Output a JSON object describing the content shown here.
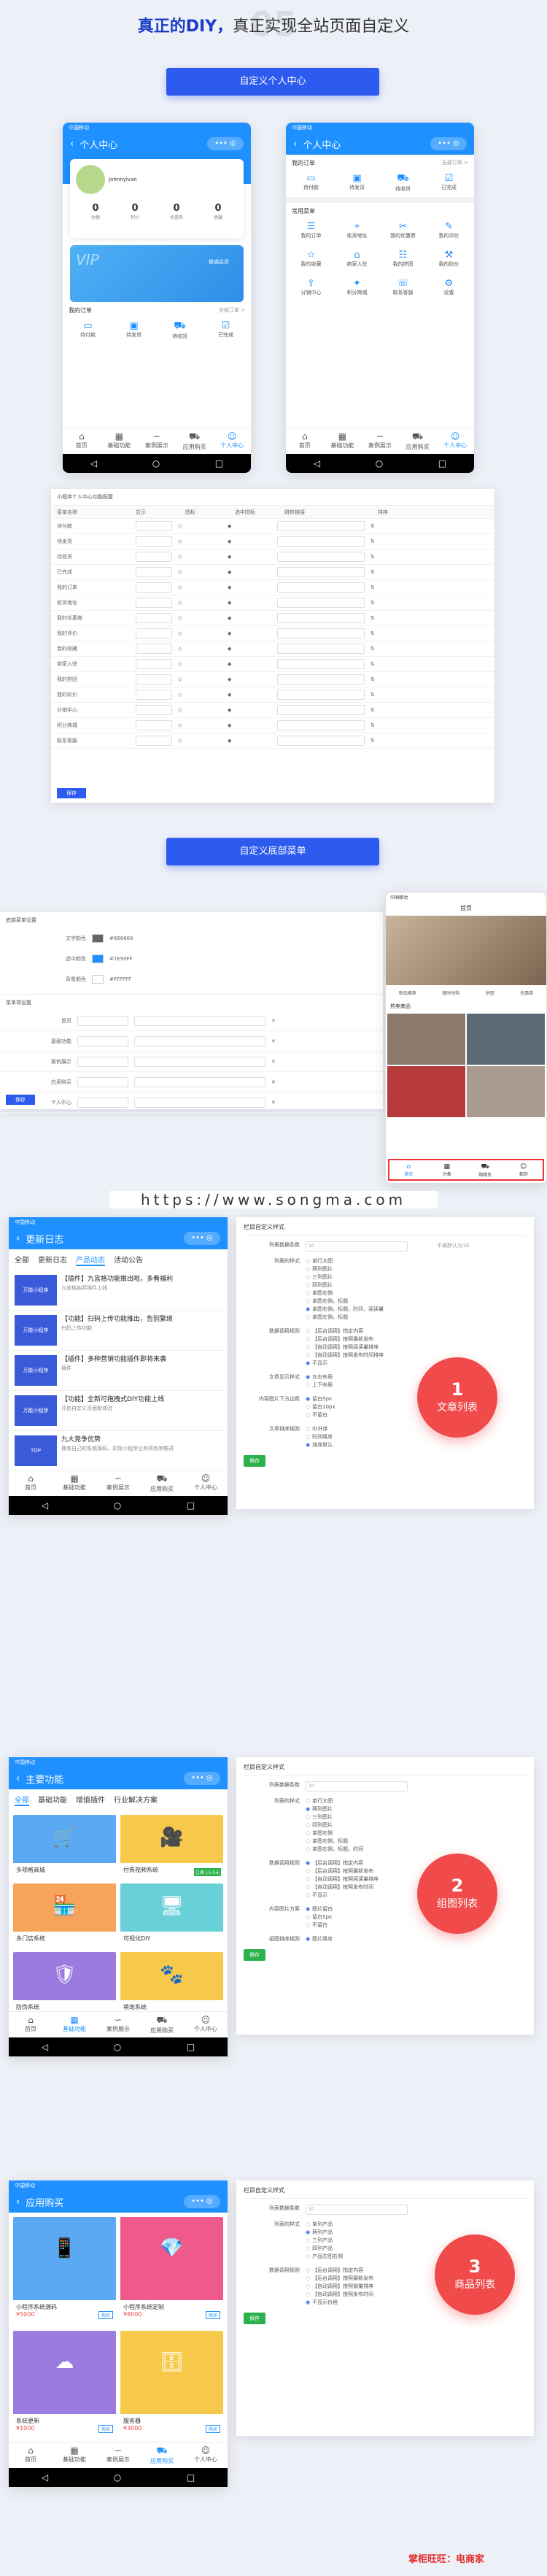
{
  "hero": {
    "bold": "真正的DIY，",
    "rest": "真正实现全站页面自定义",
    "num": "05"
  },
  "pill1": "自定义个人中心",
  "pill2": "自定义底部菜单",
  "status": "中国移动",
  "p1": {
    "title": "个人中心",
    "user": "Johnnylvan",
    "stats": [
      {
        "v": "0",
        "l": "余额"
      },
      {
        "v": "0",
        "l": "积分"
      },
      {
        "v": "0",
        "l": "优惠券"
      },
      {
        "v": "0",
        "l": "收藏"
      }
    ],
    "vip": "VIP",
    "vipText": "普通会员",
    "orders": "我的订单",
    "all": "全部订单 >",
    "oitems": [
      "待付款",
      "待发货",
      "待收货",
      "已完成"
    ]
  },
  "p2": {
    "title": "个人中心",
    "orders": "我的订单",
    "all": "全部订单 >",
    "oitems": [
      "待付款",
      "待发货",
      "待收货",
      "已完成"
    ],
    "menu": "常用菜单",
    "mitems": [
      "我的订单",
      "收货地址",
      "我的优惠券",
      "我的评价",
      "我的收藏",
      "商家入驻",
      "我的拼团",
      "我的砍价",
      "分销中心",
      "积分商城",
      "联系客服",
      "设置"
    ]
  },
  "tabs": [
    "首页",
    "基础功能",
    "案例展示",
    "应用购买",
    "个人中心"
  ],
  "admin1": {
    "title": "小程序个人中心功能配置",
    "cols": [
      "菜单名称",
      "显示",
      "图标",
      "选中图标",
      "跳转链接",
      "排序"
    ],
    "rows": [
      "待付款",
      "待发货",
      "待收货",
      "已完成",
      "我的订单",
      "收货地址",
      "我的优惠券",
      "我的评价",
      "我的收藏",
      "商家入驻",
      "我的拼团",
      "我的砍价",
      "分销中心",
      "积分商城",
      "联系客服"
    ],
    "save": "保存"
  },
  "admin2": {
    "title": "底部菜单设置",
    "rows": [
      {
        "l": "文字颜色",
        "v": "#666666"
      },
      {
        "l": "选中颜色",
        "v": "#1E90FF"
      },
      {
        "l": "背景颜色",
        "v": "#FFFFFF"
      }
    ],
    "section": "菜单项设置",
    "items": [
      "首页",
      "基础功能",
      "案例展示",
      "应用购买",
      "个人中心"
    ],
    "save": "保存"
  },
  "p3": {
    "title": "首页",
    "hot": "热卖商品",
    "tabs": [
      "首页",
      "分类",
      "购物车",
      "我的"
    ],
    "menus": [
      "新品推荐",
      "限时抢购",
      "拼团",
      "优惠券"
    ]
  },
  "url": "https://www.songma.com",
  "p4": {
    "title": "更新日志",
    "tabs": [
      "全部",
      "更新日志",
      "产品动态",
      "活动公告"
    ],
    "arts": [
      {
        "t": "【插件】九宫格功能推出啦，多看福利",
        "d": "九宫格抽奖插件上线",
        "th": "万能小程序"
      },
      {
        "t": "【功能】扫码上传功能推出，告别繁琐",
        "d": "扫码上传功能",
        "th": "万能小程序"
      },
      {
        "t": "【插件】多种营销功能插件即将来袭",
        "d": "插件",
        "th": "万能小程序"
      },
      {
        "t": "【功能】全新可拖拽式DIY功能上线",
        "d": "开启自定义页面新体验",
        "th": "万能小程序"
      },
      {
        "t": "九大竞争优势",
        "d": "拥有自己的系统源码，实现小程序业务将有序推进",
        "th": "TOP"
      }
    ]
  },
  "cfg1": {
    "title": "栏目自定义样式",
    "rows": [
      {
        "l": "列表数据条数",
        "v": "10",
        "n": "不填默认为10"
      },
      {
        "l": "列表的样式",
        "opts": [
          "单行大图",
          "两列图片",
          "三列图片",
          "四列图片",
          "单图右侧",
          "单图右侧，标题",
          "单图右侧，标题，时间，阅读量",
          "单图左侧，标题"
        ],
        "sel": 6
      },
      {
        "l": "数据调用规则",
        "opts": [
          "【后台调用】指定内容",
          "【后台调用】按照最新发布",
          "【自动调用】按照阅读量排序",
          "【自动调用】按照发布时间排序",
          "不显示"
        ],
        "sel": 4
      },
      {
        "l": "文章显示样式",
        "opts": [
          "左右布局",
          "上下布局"
        ],
        "sel": 0
      },
      {
        "l": "内容图片下方边距",
        "opts": [
          "留白5px",
          "留白10px",
          "不留白"
        ],
        "sel": 0
      },
      {
        "l": "文章排序规则",
        "opts": [
          "ID升序",
          "时间降序",
          "排序默认"
        ],
        "sel": 2
      }
    ],
    "save": "保存",
    "badge": "文章列表",
    "num": "1"
  },
  "p5": {
    "title": "主要功能",
    "tabs": [
      "全部",
      "基础功能",
      "增值插件",
      "行业解决方案"
    ],
    "cards": [
      {
        "t": "多规格商城",
        "c": "#5aa9f2",
        "i": "🛒"
      },
      {
        "t": "付费视频系统",
        "c": "#f7c94b",
        "i": "🎥"
      },
      {
        "t": "多门店系统",
        "c": "#f7a35a",
        "i": "🏪"
      },
      {
        "t": "可视化DIY",
        "c": "#6ad0d8",
        "i": "🖥"
      },
      {
        "t": "防伪系统",
        "c": "#9b7be0",
        "i": "🛡"
      },
      {
        "t": "萌宠系统",
        "c": "#f7c94b",
        "i": "🐾"
      }
    ],
    "tag": "已满 15.0元"
  },
  "cfg2": {
    "title": "栏目自定义样式",
    "rows": [
      {
        "l": "列表数据条数",
        "v": "10"
      },
      {
        "l": "列表的样式",
        "opts": [
          "单行大图",
          "两列图片",
          "三列图片",
          "四列图片",
          "单图右侧",
          "单图右侧，标题",
          "单图右侧，标题，时间"
        ],
        "sel": 1
      },
      {
        "l": "数据调用规则",
        "opts": [
          "【后台调用】指定内容",
          "【后台调用】按照最新发布",
          "【自动调用】按照阅读量排序",
          "【自动调用】按照发布时间",
          "不显示"
        ],
        "sel": 0
      },
      {
        "l": "内容图片方案",
        "opts": [
          "图片留白",
          "留白5px",
          "不留白"
        ],
        "sel": 0
      },
      {
        "l": "组图排序规则",
        "opts": [
          "图片降序"
        ],
        "sel": 0
      }
    ],
    "save": "保存",
    "badge": "组图列表",
    "num": "2"
  },
  "p6": {
    "title": "应用购买",
    "cards": [
      {
        "t": "小程序系统源码",
        "p": "¥5000",
        "c": "#5aa9f2",
        "i": "📱"
      },
      {
        "t": "小程序系统定制",
        "p": "¥8000",
        "c": "#ef5a8a",
        "i": "💎"
      },
      {
        "t": "系统更新",
        "p": "¥1000",
        "c": "#9b7be0",
        "i": "☁"
      },
      {
        "t": "服务器",
        "p": "¥3000",
        "c": "#f7c94b",
        "i": "🗄"
      }
    ],
    "buy": "购买"
  },
  "cfg3": {
    "title": "栏目自定义样式",
    "rows": [
      {
        "l": "列表数据条数",
        "v": "10"
      },
      {
        "l": "列表的样式",
        "opts": [
          "单列产品",
          "两列产品",
          "三列产品",
          "四列产品",
          "产品左图右侧"
        ],
        "sel": 1
      },
      {
        "l": "数据调用规则",
        "opts": [
          "【后台调用】指定内容",
          "【后台调用】按照最新发布",
          "【自动调用】按照销量排序",
          "【自动调用】按照发布时间",
          "不显示价格"
        ],
        "sel": 4
      }
    ],
    "save": "保存",
    "badge": "商品列表",
    "num": "3"
  },
  "watermark": "掌柜旺旺：电商家"
}
